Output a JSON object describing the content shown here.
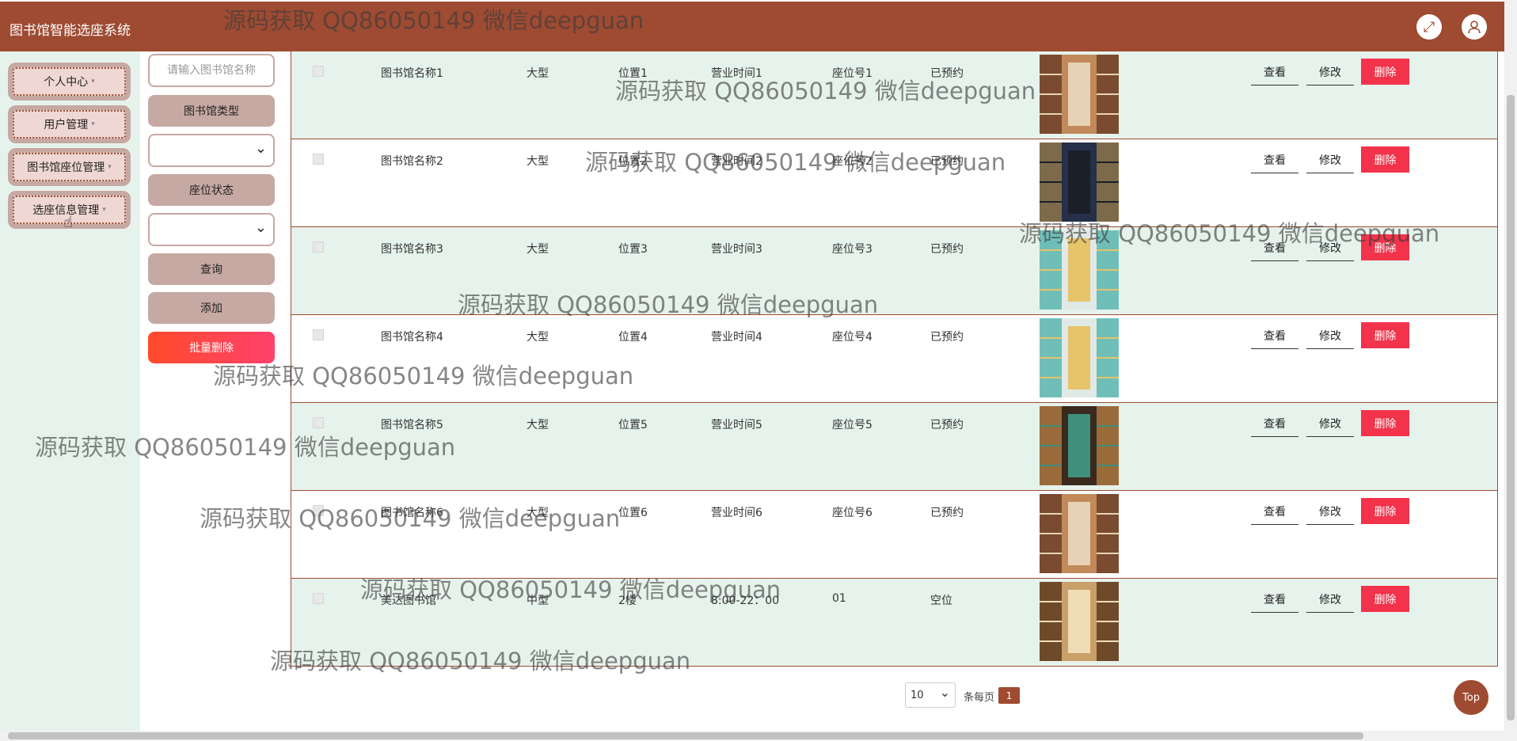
{
  "app": {
    "title": "图书馆智能选座系统"
  },
  "header_icons": [
    "fullscreen-icon",
    "user-avatar-icon"
  ],
  "sidebar": {
    "items": [
      {
        "label": "个人中心"
      },
      {
        "label": "用户管理"
      },
      {
        "label": "图书馆座位管理"
      },
      {
        "label": "选座信息管理"
      }
    ]
  },
  "filters": {
    "name_placeholder": "请输入图书馆名称",
    "type_label": "图书馆类型",
    "type_value": "",
    "status_label": "座位状态",
    "status_value": "",
    "search_label": "查询",
    "add_label": "添加",
    "batch_delete_label": "批量删除"
  },
  "table": {
    "rows": [
      {
        "name": "图书馆名称1",
        "type": "大型",
        "location": "位置1",
        "hours": "营业时间1",
        "seat": "座位号1",
        "status": "已预约",
        "image": "tall-shelves"
      },
      {
        "name": "图书馆名称2",
        "type": "大型",
        "location": "位置2",
        "hours": "营业时间2",
        "seat": "座位号2",
        "status": "已预约",
        "image": "dark-hall"
      },
      {
        "name": "图书馆名称3",
        "type": "大型",
        "location": "位置3",
        "hours": "营业时间3",
        "seat": "座位号3",
        "status": "已预约",
        "image": "reading-room"
      },
      {
        "name": "图书馆名称4",
        "type": "大型",
        "location": "位置4",
        "hours": "营业时间4",
        "seat": "座位号4",
        "status": "已预约",
        "image": "reading-room"
      },
      {
        "name": "图书馆名称5",
        "type": "大型",
        "location": "位置5",
        "hours": "营业时间5",
        "seat": "座位号5",
        "status": "已预约",
        "image": "lamp-library"
      },
      {
        "name": "图书馆名称6",
        "type": "大型",
        "location": "位置6",
        "hours": "营业时间6",
        "seat": "座位号6",
        "status": "已预约",
        "image": "tall-shelves"
      },
      {
        "name": "美达图书馆",
        "type": "中型",
        "location": "2楼",
        "hours": "8:00-22：00",
        "seat": "01",
        "status": "空位",
        "image": "warm-aisle"
      }
    ],
    "actions": {
      "view": "查看",
      "edit": "修改",
      "delete": "删除"
    }
  },
  "pagination": {
    "page_size": "10",
    "per_page_label": "条每页",
    "current_page": "1"
  },
  "top_button": "Top",
  "watermark": "源码获取 QQ86050149 微信deepguan",
  "colors": {
    "brand": "#9e4b32",
    "sidebar_bg": "#e6f3ec",
    "delete": "#f2334b",
    "button_bg": "#c6a9a2"
  }
}
